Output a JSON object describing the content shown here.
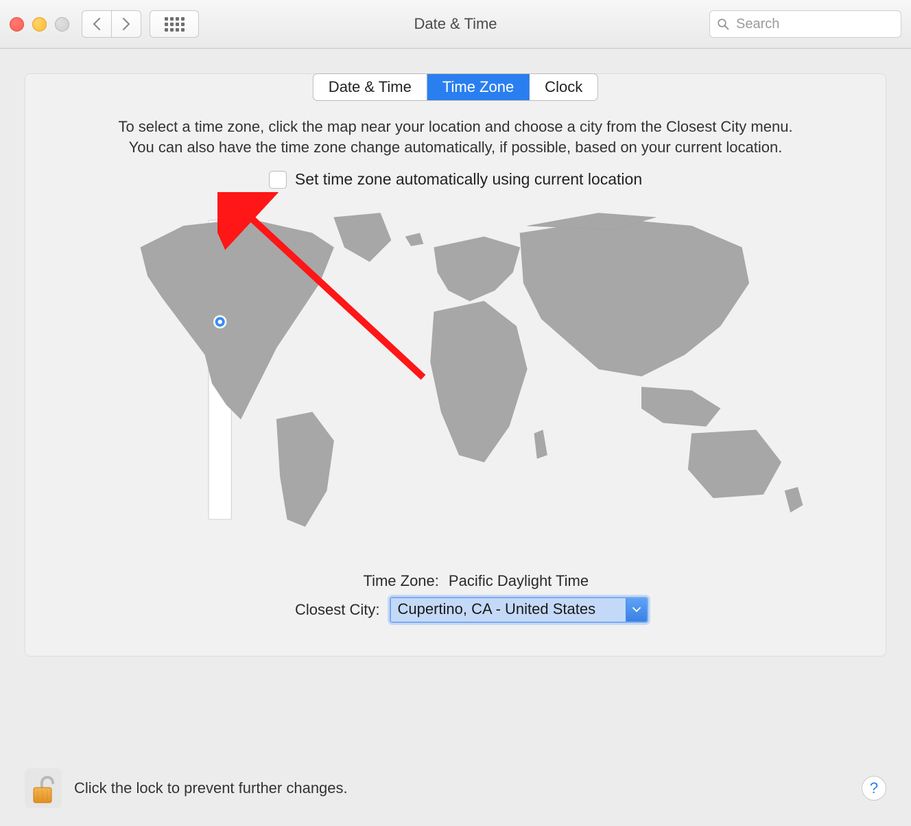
{
  "window": {
    "title": "Date & Time"
  },
  "search": {
    "placeholder": "Search"
  },
  "tabs": {
    "date_time": "Date & Time",
    "time_zone": "Time Zone",
    "clock": "Clock"
  },
  "instructions": {
    "line1": "To select a time zone, click the map near your location and choose a city from the Closest City menu.",
    "line2": "You can also have the time zone change automatically, if possible, based on your current location."
  },
  "auto_checkbox_label": "Set time zone automatically using current location",
  "timezone": {
    "label": "Time Zone:",
    "value": "Pacific Daylight Time"
  },
  "closest_city": {
    "label": "Closest City:",
    "value": "Cupertino, CA - United States"
  },
  "lock_text": "Click the lock to prevent further changes.",
  "help_label": "?"
}
